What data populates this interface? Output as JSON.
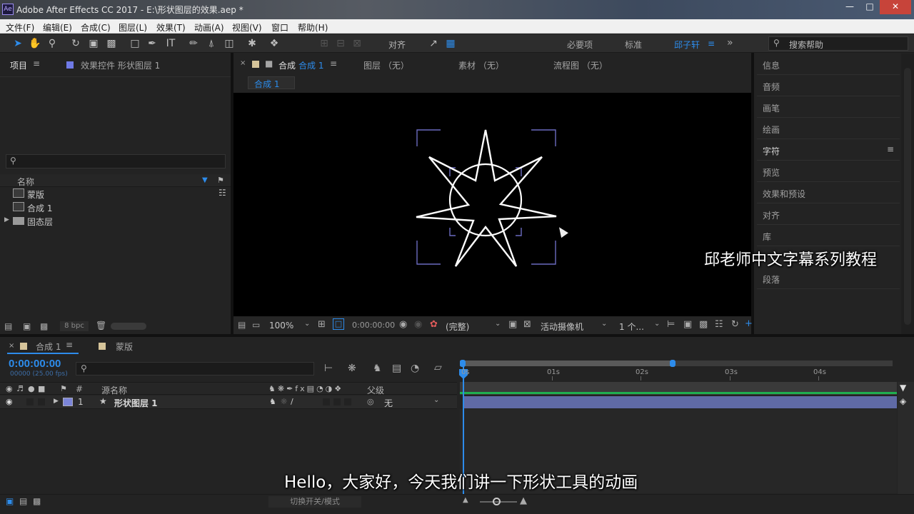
{
  "window": {
    "app_icon": "Ae",
    "title": "Adobe After Effects CC 2017 - E:\\形状图层的效果.aep *"
  },
  "menu": [
    "文件(F)",
    "编辑(E)",
    "合成(C)",
    "图层(L)",
    "效果(T)",
    "动画(A)",
    "视图(V)",
    "窗口",
    "帮助(H)"
  ],
  "toolbar": {
    "align_label": "对齐",
    "workspaces": [
      "必要项",
      "标准",
      "邱子轩"
    ],
    "active_workspace": "邱子轩",
    "search_placeholder": "搜索帮助"
  },
  "project_panel": {
    "tab_project": "项目",
    "tab_effects": "效果控件 形状图层 1",
    "column_name": "名称",
    "items": [
      {
        "name": "蒙版",
        "type": "comp"
      },
      {
        "name": "合成 1",
        "type": "comp"
      },
      {
        "name": "固态层",
        "type": "folder"
      }
    ],
    "bpc": "8 bpc"
  },
  "viewer": {
    "tab_comp_prefix": "合成",
    "tab_comp_name": "合成 1",
    "tab_layer": "图层 （无）",
    "tab_footage": "素材 （无）",
    "tab_flowchart": "流程图 （无）",
    "breadcrumb": "合成 1",
    "zoom": "100%",
    "timecode": "0:00:00:00",
    "resolution": "(完整)",
    "camera": "活动摄像机",
    "views": "1 个..."
  },
  "right_panels": [
    "信息",
    "音频",
    "画笔",
    "绘画",
    "字符",
    "预览",
    "效果和预设",
    "对齐",
    "库",
    "段落"
  ],
  "timeline": {
    "comp_tab": "合成 1",
    "mask_tab": "蒙版",
    "timecode": "0:00:00:00",
    "fps": "00000 (25.00 fps)",
    "col_hash": "#",
    "col_source": "源名称",
    "col_parent": "父级",
    "layer_number": "1",
    "layer_name": "形状图层 1",
    "parent_value": "无",
    "ruler": [
      "0s",
      "01s",
      "02s",
      "03s",
      "04s"
    ],
    "toggle_label": "切换开关/模式"
  },
  "colors": {
    "accent_blue": "#2d8ceb",
    "layer_label": "#7b85d9",
    "layer_bar": "#5f6aa5",
    "track_green": "#1fae50"
  },
  "subtitles": {
    "watermark": "邱老师中文字幕系列教程",
    "caption": "Hello，大家好，今天我们讲一下形状工具的动画"
  }
}
